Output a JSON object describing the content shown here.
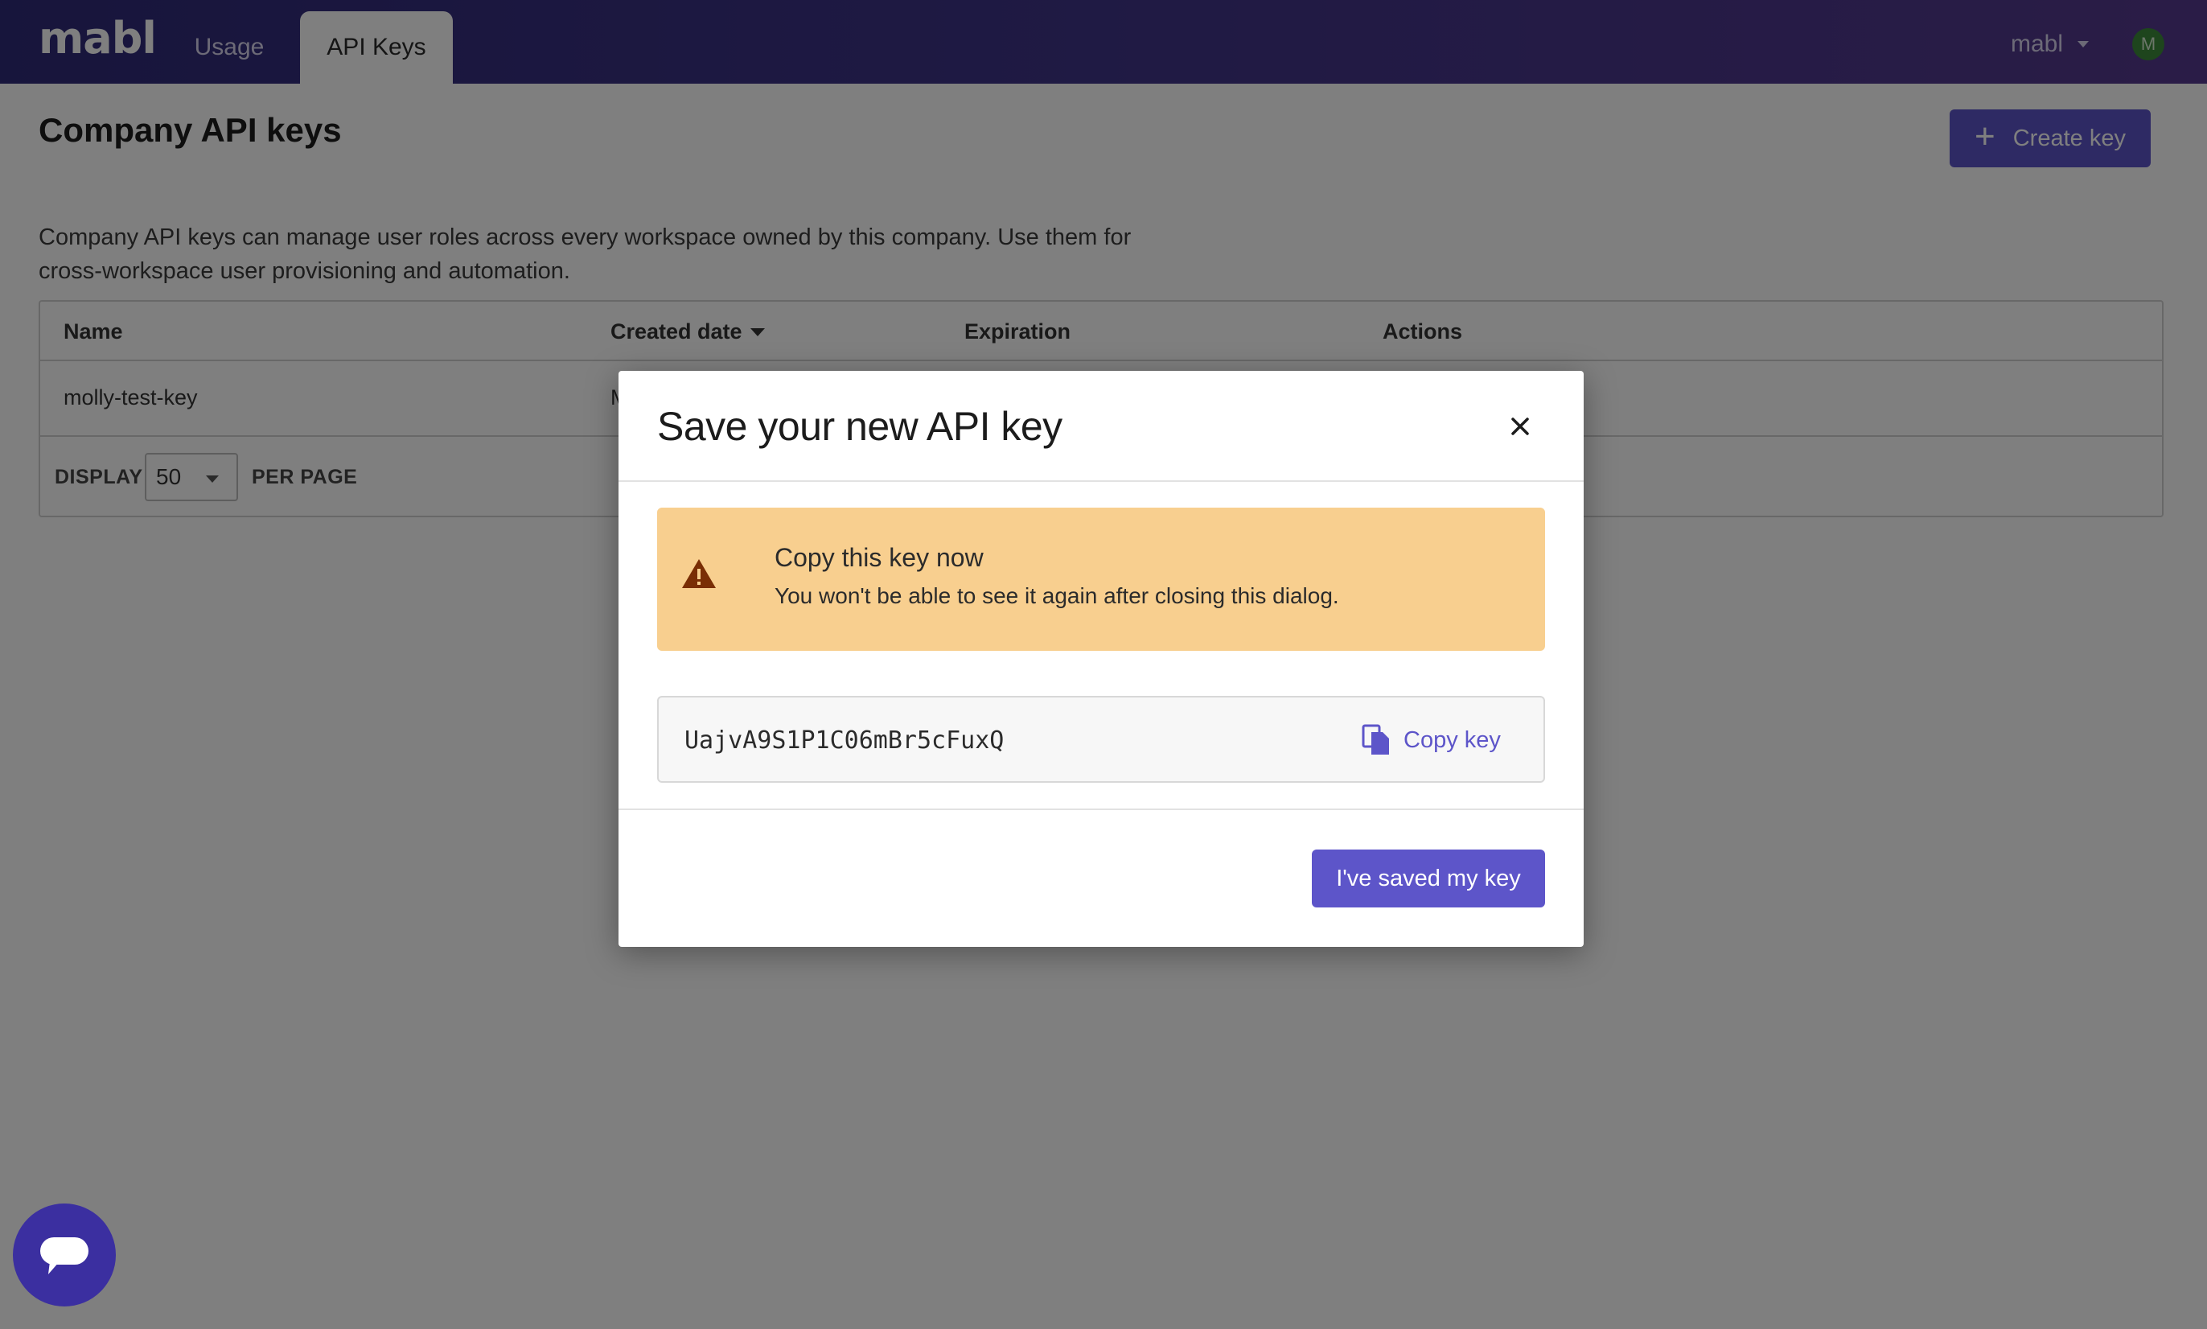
{
  "nav": {
    "logo": "mabl",
    "tabs": [
      {
        "label": "Usage"
      },
      {
        "label": "API Keys"
      }
    ],
    "account_label": "mabl",
    "avatar_initial": "M"
  },
  "page": {
    "title": "Company API keys",
    "create_button": "Create key",
    "description": "Company API keys can manage user roles across every workspace owned by this company. Use them for cross-workspace user provisioning and automation."
  },
  "table": {
    "columns": [
      "Name",
      "Created date",
      "Expiration",
      "Actions"
    ],
    "rows": [
      {
        "name": "molly-test-key",
        "created": "M"
      }
    ],
    "pager": {
      "display_label": "DISPLAY",
      "per_page_value": "50",
      "per_page_label": "PER PAGE"
    }
  },
  "modal": {
    "title": "Save your new API key",
    "alert": {
      "title": "Copy this key now",
      "text": "You won't be able to see it again after closing this dialog."
    },
    "api_key": "UajvA9S1P1C06mBr5cFuxQ",
    "copy_button": "Copy key",
    "confirm_button": "I've saved my key"
  },
  "colors": {
    "nav_gradient_start": "#2f2a78",
    "nav_gradient_end": "#55398e",
    "primary": "#5d55c9",
    "warning_bg": "#f8cf8f",
    "warning_icon": "#7a2e05",
    "chat_fab": "#3b2fa0"
  },
  "icons": {
    "close": "close-icon",
    "warning": "warning-icon",
    "copy": "copy-icon",
    "chat": "chat-icon",
    "plus": "plus-icon"
  }
}
